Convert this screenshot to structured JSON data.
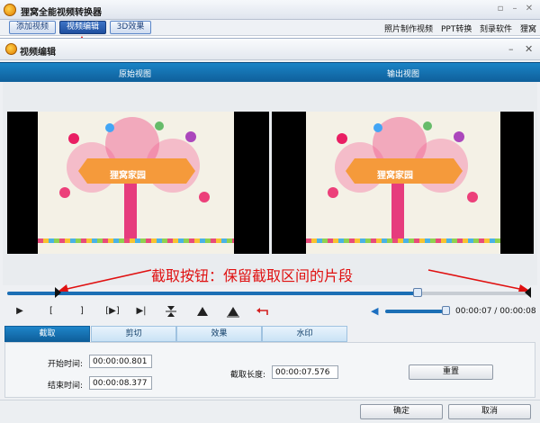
{
  "app": {
    "title": "狸窝全能视频转换器",
    "tabs": [
      {
        "label": "添加视频",
        "active": false
      },
      {
        "label": "视频编辑",
        "active": true
      },
      {
        "label": "3D效果",
        "active": false
      }
    ],
    "links": [
      "照片制作视频",
      "PPT转换",
      "刻录软件",
      "狸窝"
    ]
  },
  "dialog": {
    "title": "视频编辑",
    "original_view_label": "原始视图",
    "output_view_label": "输出视图",
    "banner_text": "狸窝家园",
    "annotation": "截取按钮：保留截取区间的片段",
    "timeline": {
      "start_fraction": 0.1,
      "current_fraction": 0.8,
      "end_fraction": 1.0
    },
    "controls": {
      "play": "▶",
      "mark_in": "[",
      "mark_out": "]",
      "goto_in": "[▶]",
      "goto_end": "▶|",
      "current_time": "00:00:07",
      "total_time": "00:00:08",
      "volume_fraction": 1.0
    },
    "tabs": [
      {
        "label": "截取",
        "active": true
      },
      {
        "label": "剪切",
        "active": false
      },
      {
        "label": "效果",
        "active": false
      },
      {
        "label": "水印",
        "active": false
      }
    ],
    "trim": {
      "start_label": "开始时间:",
      "start_value": "00:00:00.801",
      "end_label": "结束时间:",
      "end_value": "00:00:08.377",
      "length_label": "截取长度:",
      "length_value": "00:00:07.576",
      "reset_label": "重置"
    },
    "footer": {
      "ok_label": "确定",
      "cancel_label": "取消"
    }
  },
  "colors": {
    "accent": "#1273b8",
    "annotation": "#e01010"
  }
}
